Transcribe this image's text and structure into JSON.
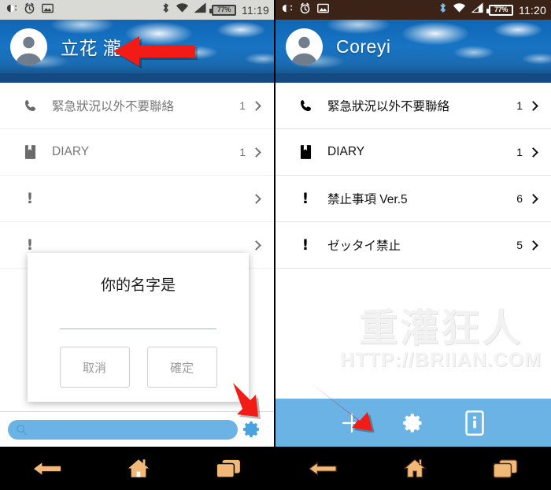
{
  "left_screen": {
    "statusbar": {
      "icons": [
        "brightness-icon",
        "alarm-icon",
        "image-icon"
      ],
      "right_icons": [
        "bluetooth-icon",
        "wifi-icon",
        "signal-icon"
      ],
      "battery": "77%",
      "time": "11:19"
    },
    "header": {
      "avatar": "person-avatar-icon",
      "name": "立花 瀧"
    },
    "list": [
      {
        "icon": "phone-icon",
        "label": "緊急狀況以外不要聯絡",
        "count": "1",
        "chevron": "chevron-right-icon"
      },
      {
        "icon": "book-icon",
        "label": "DIARY",
        "count": "1",
        "chevron": "chevron-right-icon"
      },
      {
        "icon": "exclamation-icon",
        "label": "",
        "count": "",
        "chevron": "chevron-right-icon"
      },
      {
        "icon": "exclamation-icon",
        "label": "",
        "count": "",
        "chevron": "chevron-right-icon"
      }
    ],
    "dialog": {
      "title": "你的名字是",
      "input_value": "",
      "input_placeholder": "",
      "cancel_label": "取消",
      "confirm_label": "確定"
    },
    "searchbar": {
      "search_icon": "search-icon",
      "search_value": "",
      "search_placeholder": "",
      "gear_icon": "gear-icon"
    },
    "navbar": [
      "back-icon",
      "home-icon",
      "recents-icon"
    ]
  },
  "right_screen": {
    "statusbar": {
      "icons": [
        "brightness-icon",
        "alarm-icon",
        "image-icon"
      ],
      "right_icons": [
        "bluetooth-icon",
        "wifi-icon",
        "signal-icon"
      ],
      "battery": "77%",
      "time": "11:20"
    },
    "header": {
      "avatar": "person-avatar-icon",
      "name": "Coreyi"
    },
    "list": [
      {
        "icon": "phone-icon",
        "label": "緊急狀況以外不要聯絡",
        "count": "1",
        "chevron": "chevron-right-icon"
      },
      {
        "icon": "book-icon",
        "label": "DIARY",
        "count": "1",
        "chevron": "chevron-right-icon"
      },
      {
        "icon": "exclamation-icon",
        "label": "禁止事項 Ver.5",
        "count": "6",
        "chevron": "chevron-right-icon"
      },
      {
        "icon": "exclamation-icon",
        "label": "ゼッタイ禁止",
        "count": "5",
        "chevron": "chevron-right-icon"
      }
    ],
    "watermark": {
      "title": "重灌狂人",
      "url": "HTTP://BRIIAN.COM"
    },
    "actionbar": [
      "plus-icon",
      "gear-icon",
      "info-phone-icon"
    ],
    "navbar": [
      "back-icon",
      "home-icon",
      "recents-icon"
    ]
  },
  "colors": {
    "accent_blue": "#6bb3e4",
    "header_blue": "#1874c4",
    "header_band": "#134a82",
    "arrow_red": "#f21b16",
    "statusbar_light": "#d9d9d6",
    "statusbar_dark": "#3b2417",
    "nav_wood": "#5a3520",
    "nav_icon_wood": "#f0b978"
  }
}
